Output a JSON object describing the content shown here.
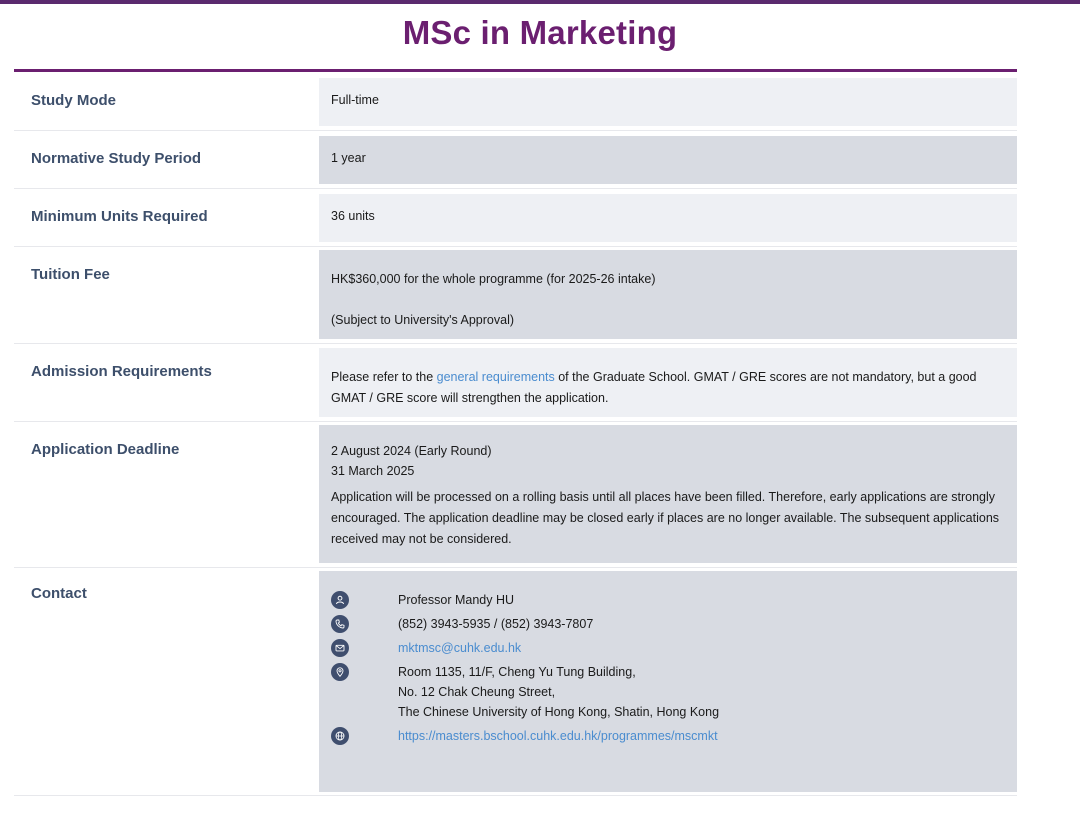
{
  "page": {
    "title": "MSc in Marketing"
  },
  "rows": {
    "study_mode": {
      "label": "Study Mode",
      "value": "Full-time"
    },
    "period": {
      "label": "Normative Study Period",
      "value": "1 year"
    },
    "units": {
      "label": "Minimum Units Required",
      "value": "36 units"
    },
    "fee": {
      "label": "Tuition Fee",
      "line1": "HK$360,000 for the whole programme (for 2025-26 intake)",
      "line2": "(Subject to University's Approval)"
    },
    "admission": {
      "label": "Admission Requirements",
      "prefix": "Please refer to the ",
      "link_text": "general requirements",
      "suffix": " of the Graduate School. GMAT / GRE scores are not mandatory, but a good GMAT / GRE score will strengthen the application."
    },
    "deadline": {
      "label": "Application Deadline",
      "date1": "2 August 2024 (Early Round)",
      "date2": "31 March 2025",
      "note": "Application will be processed on a rolling basis until all places have been filled. Therefore, early applications are strongly encouraged. The application deadline may be closed early if places are no longer available. The subsequent applications received may not be considered."
    },
    "contact": {
      "label": "Contact",
      "name": "Professor Mandy HU",
      "phone": "(852) 3943-5935 / (852) 3943-7807",
      "email": "mktmsc@cuhk.edu.hk",
      "address1": "Room 1135, 11/F, Cheng Yu Tung Building,",
      "address2": "No. 12 Chak Cheung Street,",
      "address3": "The Chinese University of Hong Kong, Shatin, Hong Kong",
      "website": "https://masters.bschool.cuhk.edu.hk/programmes/mscmkt",
      "icons": [
        "person-icon",
        "phone-icon",
        "email-icon",
        "location-icon",
        "globe-icon"
      ]
    }
  },
  "colors": {
    "title": "#6b1f70",
    "label": "#3d4f6b",
    "link": "#4a8ccf",
    "value_bg_light": "#eef0f4",
    "value_bg_dark": "#d8dbe2",
    "icon_bg": "#3f4e6e"
  }
}
